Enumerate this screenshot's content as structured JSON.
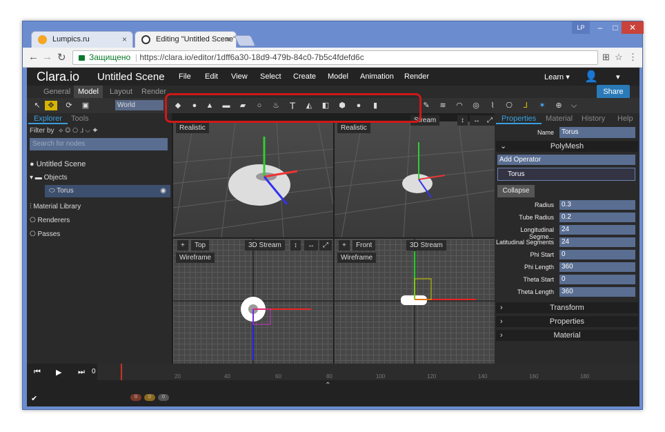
{
  "browser": {
    "tabs": [
      {
        "title": "Lumpics.ru",
        "close": "×"
      },
      {
        "title": "Editing \"Untitled Scene\"",
        "close": "×"
      }
    ],
    "profile": "LP",
    "secure_label": "Защищено",
    "url": "https://clara.io/editor/1dff6a30-18d9-479b-84c0-7b5c4fdefd6c"
  },
  "app": {
    "logo": "Clara.io",
    "scene_title": "Untitled Scene",
    "menus": [
      "File",
      "Edit",
      "View",
      "Select",
      "Create",
      "Model",
      "Animation",
      "Render"
    ],
    "learn": "Learn ▾",
    "share": "Share",
    "mode_tabs": [
      "General",
      "Model",
      "Layout",
      "Render"
    ],
    "coord_space": "World"
  },
  "left_panel": {
    "tabs": [
      "Explorer",
      "Tools"
    ],
    "filter_label": "Filter by",
    "search_placeholder": "Search for nodes",
    "tree": {
      "scene": "Untitled Scene",
      "objects": "Objects",
      "torus": "Torus",
      "material_library": "Material Library",
      "renderers": "Renderers",
      "passes": "Passes"
    }
  },
  "viewports": {
    "realistic": "Realistic",
    "stream": "Stream",
    "stream_3d": "3D Stream",
    "top": "Top",
    "front": "Front",
    "wireframe": "Wireframe",
    "plus": "+"
  },
  "right_panel": {
    "tabs": [
      "Properties",
      "Material",
      "History",
      "Help"
    ],
    "name_label": "Name",
    "name_value": "Torus",
    "section": "PolyMesh",
    "add_operator": "Add Operator",
    "operator": "Torus",
    "collapse": "Collapse",
    "params": [
      {
        "label": "Radius",
        "value": "0.3"
      },
      {
        "label": "Tube Radius",
        "value": "0.2"
      },
      {
        "label": "Longitudinal Segme...",
        "value": "24"
      },
      {
        "label": "Latitudinal Segments",
        "value": "24"
      },
      {
        "label": "Phi Start",
        "value": "0"
      },
      {
        "label": "Phi Length",
        "value": "360"
      },
      {
        "label": "Theta Start",
        "value": "0"
      },
      {
        "label": "Theta Length",
        "value": "360"
      }
    ],
    "sections": [
      "Transform",
      "Properties",
      "Material"
    ]
  },
  "timeline": {
    "current_frame": "0",
    "ticks": [
      "20",
      "40",
      "60",
      "80",
      "100",
      "120",
      "140",
      "160",
      "180"
    ],
    "badges": [
      "0",
      "0",
      "0"
    ]
  },
  "colors": {
    "accent": "#3aa0e0",
    "highlight": "#d01818",
    "share": "#2a7ab8"
  }
}
